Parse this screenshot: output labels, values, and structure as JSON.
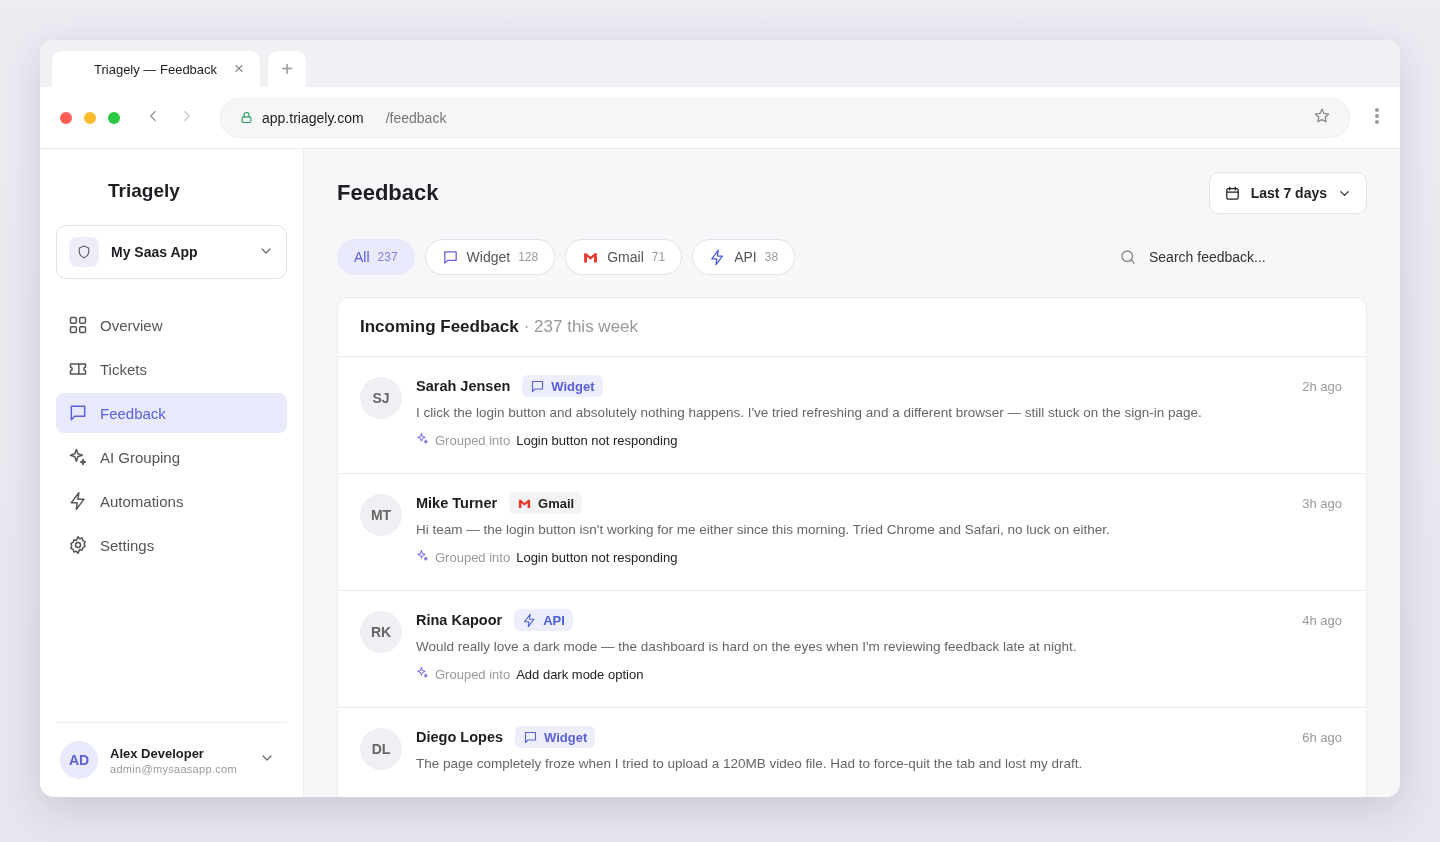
{
  "browser": {
    "tab_title": "Triagely — Feedback",
    "tab_close": "×",
    "new_tab": "+",
    "url_host": "app.triagely.com",
    "url_path": "/feedback"
  },
  "sidebar": {
    "brand": "Triagely",
    "workspace": "My Saas App",
    "items": [
      {
        "label": "Overview",
        "kind": "grid",
        "selected": false
      },
      {
        "label": "Tickets",
        "kind": "ticket",
        "selected": false
      },
      {
        "label": "Feedback",
        "kind": "chat",
        "selected": true
      },
      {
        "label": "AI Grouping",
        "kind": "sparkle",
        "selected": false
      },
      {
        "label": "Automations",
        "kind": "bolt",
        "selected": false
      },
      {
        "label": "Settings",
        "kind": "gear",
        "selected": false
      }
    ],
    "user": {
      "initials": "AD",
      "name": "Alex Developer",
      "email": "admin@mysaasapp.com"
    }
  },
  "header": {
    "title": "Feedback",
    "date_range": "Last 7 days"
  },
  "filters": [
    {
      "label": "All",
      "count": "237",
      "kind": "all",
      "selected": true
    },
    {
      "label": "Widget",
      "count": "128",
      "kind": "widget",
      "selected": false
    },
    {
      "label": "Gmail",
      "count": "71",
      "kind": "gmail",
      "selected": false
    },
    {
      "label": "API",
      "count": "38",
      "kind": "api",
      "selected": false
    }
  ],
  "search": {
    "placeholder": "Search feedback..."
  },
  "feed": {
    "title": "Incoming Feedback",
    "subtitle": "· 237 this week",
    "items": [
      {
        "initials": "SJ",
        "name": "Sarah Jensen",
        "source": "Widget",
        "kind": "widget",
        "time": "2h ago",
        "message": "I click the login button and absolutely nothing happens. I've tried refreshing and a different browser — still stuck on the sign-in page.",
        "grouped_label": "Grouped into",
        "group": "Login button not responding"
      },
      {
        "initials": "MT",
        "name": "Mike Turner",
        "source": "Gmail",
        "kind": "gmail",
        "time": "3h ago",
        "message": "Hi team — the login button isn't working for me either since this morning. Tried Chrome and Safari, no luck on either.",
        "grouped_label": "Grouped into",
        "group": "Login button not responding"
      },
      {
        "initials": "RK",
        "name": "Rina Kapoor",
        "source": "API",
        "kind": "api",
        "time": "4h ago",
        "message": "Would really love a dark mode — the dashboard is hard on the eyes when I'm reviewing feedback late at night.",
        "grouped_label": "Grouped into",
        "group": "Add dark mode option"
      },
      {
        "initials": "DL",
        "name": "Diego Lopes",
        "source": "Widget",
        "kind": "widget",
        "time": "6h ago",
        "message": "The page completely froze when I tried to upload a 120MB video file. Had to force-quit the tab and lost my draft."
      }
    ]
  }
}
